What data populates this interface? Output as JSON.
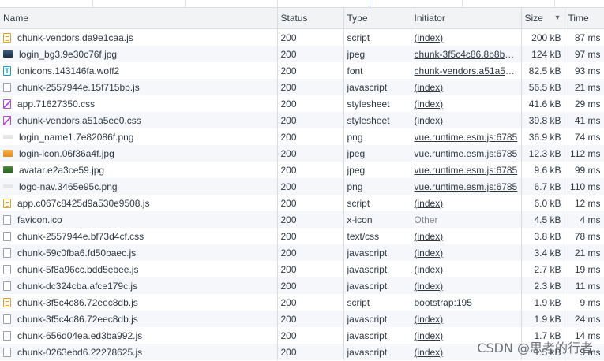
{
  "columns": {
    "name": "Name",
    "status": "Status",
    "type": "Type",
    "initiator": "Initiator",
    "size": "Size",
    "time": "Time"
  },
  "rows": [
    {
      "icon": "script",
      "name": "chunk-vendors.da9e1caa.js",
      "status": "200",
      "type": "script",
      "initiator": "(index)",
      "link": true,
      "size": "200 kB",
      "time": "87 ms"
    },
    {
      "icon": "image-dark",
      "name": "login_bg3.9e30c76f.jpg",
      "status": "200",
      "type": "jpeg",
      "initiator": "chunk-3f5c4c86.8b8b2...",
      "link": true,
      "size": "124 kB",
      "time": "97 ms"
    },
    {
      "icon": "font",
      "name": "ionicons.143146fa.woff2",
      "status": "200",
      "type": "font",
      "initiator": "chunk-vendors.a51a5e...",
      "link": true,
      "size": "82.5 kB",
      "time": "93 ms"
    },
    {
      "icon": "document",
      "name": "chunk-2557944e.15f715bb.js",
      "status": "200",
      "type": "javascript",
      "initiator": "(index)",
      "link": true,
      "size": "56.5 kB",
      "time": "21 ms"
    },
    {
      "icon": "stylesheet",
      "name": "app.71627350.css",
      "status": "200",
      "type": "stylesheet",
      "initiator": "(index)",
      "link": true,
      "size": "41.6 kB",
      "time": "29 ms"
    },
    {
      "icon": "stylesheet",
      "name": "chunk-vendors.a51a5ee0.css",
      "status": "200",
      "type": "stylesheet",
      "initiator": "(index)",
      "link": true,
      "size": "39.8 kB",
      "time": "41 ms"
    },
    {
      "icon": "image-faint",
      "name": "login_name1.7e82086f.png",
      "status": "200",
      "type": "png",
      "initiator": "vue.runtime.esm.js:6785",
      "link": true,
      "size": "36.9 kB",
      "time": "74 ms"
    },
    {
      "icon": "image-orange",
      "name": "login-icon.06f36a4f.jpg",
      "status": "200",
      "type": "jpeg",
      "initiator": "vue.runtime.esm.js:6785",
      "link": true,
      "size": "12.3 kB",
      "time": "112 ms"
    },
    {
      "icon": "image-green",
      "name": "avatar.e2a3ce59.jpg",
      "status": "200",
      "type": "jpeg",
      "initiator": "vue.runtime.esm.js:6785",
      "link": true,
      "size": "9.6 kB",
      "time": "99 ms"
    },
    {
      "icon": "image-faint",
      "name": "logo-nav.3465e95c.png",
      "status": "200",
      "type": "png",
      "initiator": "vue.runtime.esm.js:6785",
      "link": true,
      "size": "6.7 kB",
      "time": "110 ms"
    },
    {
      "icon": "script",
      "name": "app.c067c8425d9a530e9508.js",
      "status": "200",
      "type": "script",
      "initiator": "(index)",
      "link": true,
      "size": "6.0 kB",
      "time": "12 ms"
    },
    {
      "icon": "document",
      "name": "favicon.ico",
      "status": "200",
      "type": "x-icon",
      "initiator": "Other",
      "link": false,
      "size": "4.5 kB",
      "time": "4 ms"
    },
    {
      "icon": "document",
      "name": "chunk-2557944e.bf73d4cf.css",
      "status": "200",
      "type": "text/css",
      "initiator": "(index)",
      "link": true,
      "size": "3.8 kB",
      "time": "78 ms"
    },
    {
      "icon": "document",
      "name": "chunk-59c0fba6.fd50baec.js",
      "status": "200",
      "type": "javascript",
      "initiator": "(index)",
      "link": true,
      "size": "3.4 kB",
      "time": "21 ms"
    },
    {
      "icon": "document",
      "name": "chunk-5f8a96cc.bdd5ebee.js",
      "status": "200",
      "type": "javascript",
      "initiator": "(index)",
      "link": true,
      "size": "2.7 kB",
      "time": "19 ms"
    },
    {
      "icon": "document",
      "name": "chunk-dc324cba.afce179c.js",
      "status": "200",
      "type": "javascript",
      "initiator": "(index)",
      "link": true,
      "size": "2.3 kB",
      "time": "11 ms"
    },
    {
      "icon": "script",
      "name": "chunk-3f5c4c86.72eec8db.js",
      "status": "200",
      "type": "script",
      "initiator": "bootstrap:195",
      "link": true,
      "size": "1.9 kB",
      "time": "9 ms"
    },
    {
      "icon": "document",
      "name": "chunk-3f5c4c86.72eec8db.js",
      "status": "200",
      "type": "javascript",
      "initiator": "(index)",
      "link": true,
      "size": "1.9 kB",
      "time": "24 ms"
    },
    {
      "icon": "document",
      "name": "chunk-656d04ea.ed3ba992.js",
      "status": "200",
      "type": "javascript",
      "initiator": "(index)",
      "link": true,
      "size": "1.7 kB",
      "time": "14 ms"
    },
    {
      "icon": "document",
      "name": "chunk-0263ebd6.22278625.js",
      "status": "200",
      "type": "javascript",
      "initiator": "(index)",
      "link": true,
      "size": "1.5 kB",
      "time": "9 ms"
    }
  ],
  "watermark": "CSDN @思考的行者"
}
